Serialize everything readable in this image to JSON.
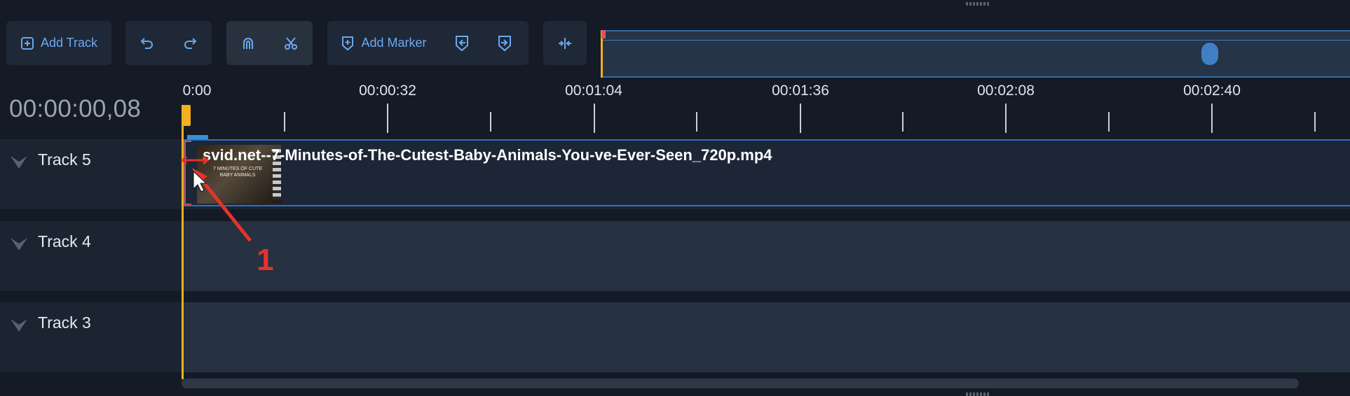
{
  "toolbar": {
    "add_track_label": "Add Track",
    "add_marker_label": "Add Marker"
  },
  "timecode": "00:00:00,08",
  "ruler": {
    "labels": [
      "0:00",
      "00:00:32",
      "00:01:04",
      "00:01:36",
      "00:02:08",
      "00:02:40"
    ]
  },
  "tracks": [
    {
      "name": "Track 5"
    },
    {
      "name": "Track 4"
    },
    {
      "name": "Track 3"
    }
  ],
  "clip": {
    "title": "svid.net--7-Minutes-of-The-Cutest-Baby-Animals-You-ve-Ever-Seen_720p.mp4",
    "thumb_text": "7 MINUTES OF CUTE BABY ANIMALS"
  },
  "annotation": {
    "number": "1"
  },
  "colors": {
    "accent": "#6aa9ef",
    "playhead": "#f2b01e",
    "clip_border": "#2e6fc0",
    "annotation": "#e6332a"
  }
}
